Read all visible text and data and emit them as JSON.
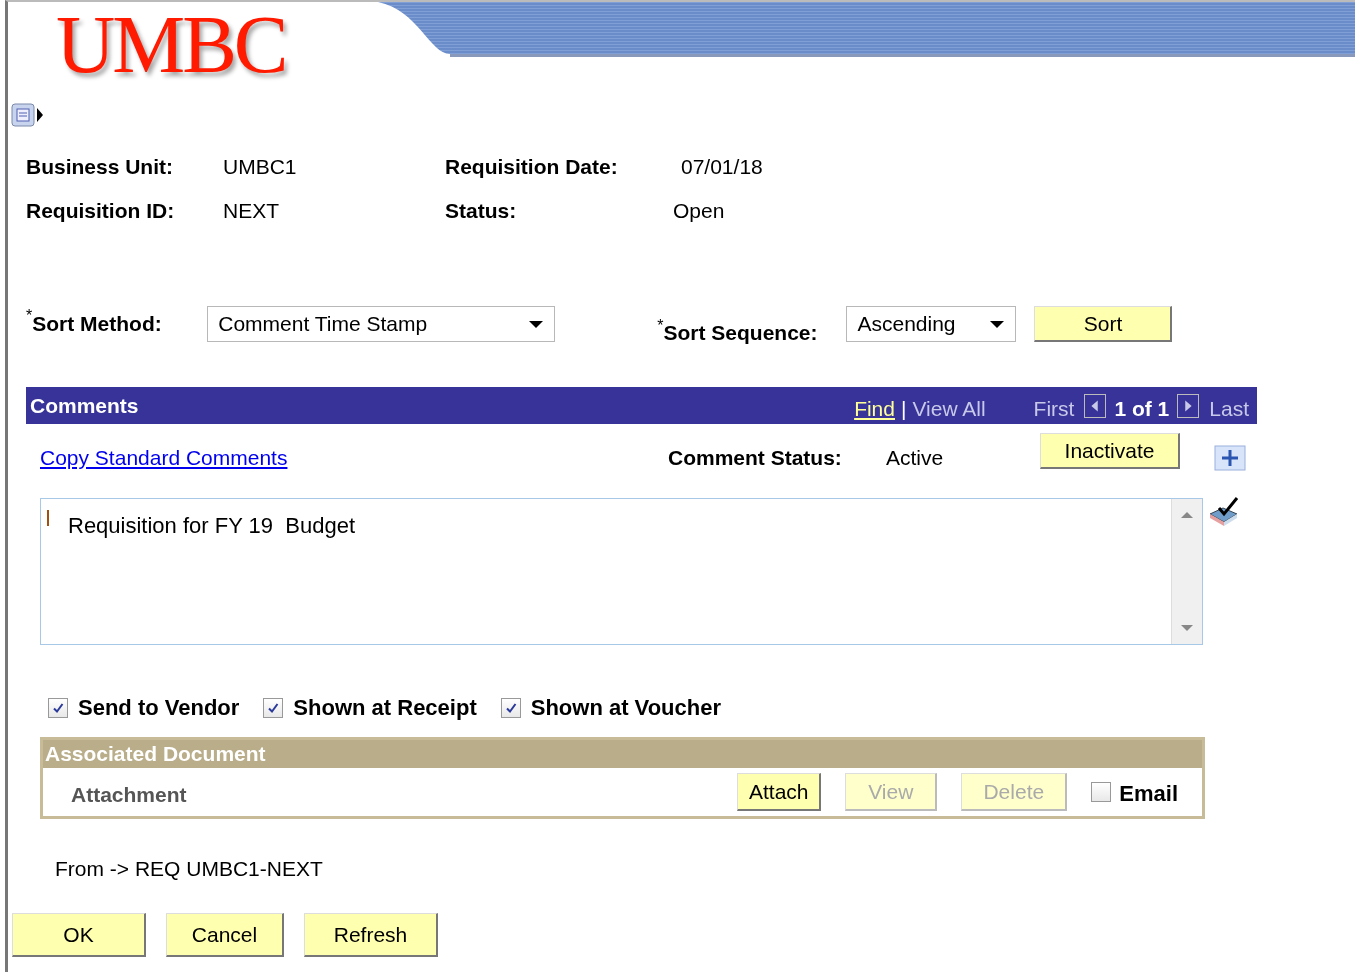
{
  "header": {
    "logo": "UMBC"
  },
  "fields": [
    {
      "label": "Business Unit:",
      "value": "UMBC1"
    },
    {
      "label": "Requisition Date:",
      "value": "07/01/18"
    },
    {
      "label": "Requisition ID:",
      "value": "NEXT"
    },
    {
      "label": "Status:",
      "value": "Open"
    }
  ],
  "sort": {
    "method_required": "*",
    "method_label": "Sort Method:",
    "method_value": "Comment Time Stamp",
    "sequence_required": "*",
    "sequence_label": "Sort Sequence:",
    "sequence_value": "Ascending",
    "button": "Sort"
  },
  "comments": {
    "title": "Comments",
    "find": "Find",
    "separator": "|",
    "view_all": "View All",
    "first": "First",
    "page": "1 of 1",
    "last": "Last",
    "copy_link": "Copy Standard Comments",
    "status_label": "Comment Status:",
    "status_value": "Active",
    "inactivate_button": "Inactivate",
    "text": "Requisition for FY 19  Budget"
  },
  "flags": [
    {
      "label": "Send to Vendor",
      "checked": true
    },
    {
      "label": "Shown at Receipt",
      "checked": true
    },
    {
      "label": "Shown at Voucher",
      "checked": true
    }
  ],
  "associated_document": {
    "title": "Associated Document",
    "attachment_label": "Attachment",
    "buttons": [
      {
        "label": "Attach",
        "disabled": false
      },
      {
        "label": "View",
        "disabled": true
      },
      {
        "label": "Delete",
        "disabled": true
      }
    ],
    "email": {
      "label": "Email",
      "checked": false
    }
  },
  "from_text": "From -> REQ UMBC1-NEXT",
  "buttons": [
    "OK",
    "Cancel",
    "Refresh"
  ]
}
